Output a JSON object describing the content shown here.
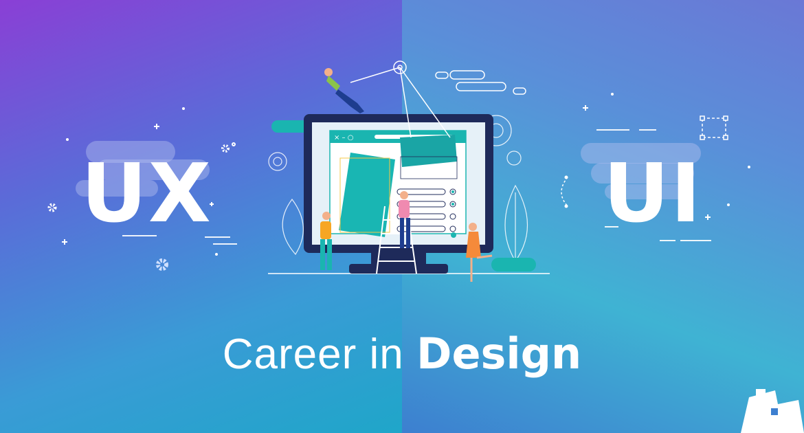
{
  "left_heading": "UX",
  "right_heading": "UI",
  "tagline": {
    "light": "Career in ",
    "bold": "Design"
  },
  "colors": {
    "left_gradient_top": "#8a3fd6",
    "right_gradient_bottom": "#3d7fd0",
    "teal": "#1ab5b0",
    "monitor": "#1e2a5a",
    "text": "#ffffff"
  },
  "window_controls": "× – ○",
  "icons": [
    "gear-icon",
    "plus-icon",
    "selection-box-icon",
    "logo-icon"
  ]
}
